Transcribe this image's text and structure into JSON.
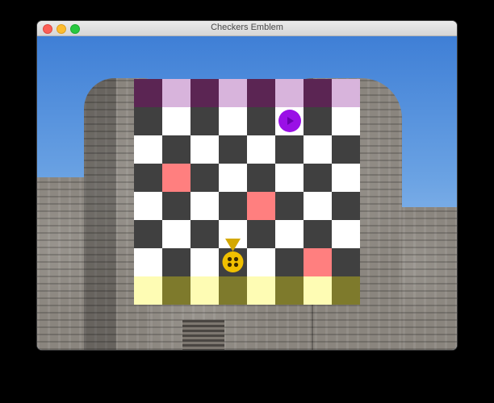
{
  "window": {
    "title": "Checkers Emblem"
  },
  "colors": {
    "dark": "#404040",
    "light": "#ffffff",
    "top_dark": "#5b2553",
    "top_light": "#d8b4dc",
    "bottom_dark": "#7e7a2c",
    "bottom_light": "#fefcb4",
    "highlight": "#ff7f7f",
    "purple_piece": "#9a10e6",
    "gold_piece": "#f0c000"
  },
  "board": {
    "rows": 8,
    "cols": 8,
    "highlighted_squares": [
      [
        3,
        1
      ],
      [
        4,
        4
      ],
      [
        6,
        6
      ]
    ],
    "pieces": [
      {
        "type": "purple-disc",
        "row": 1,
        "col": 5,
        "icon": "purple-arrow-disc-icon"
      },
      {
        "type": "gold-emblem",
        "row": 6,
        "col": 3,
        "icon": "gold-crown-emblem-icon"
      }
    ]
  }
}
